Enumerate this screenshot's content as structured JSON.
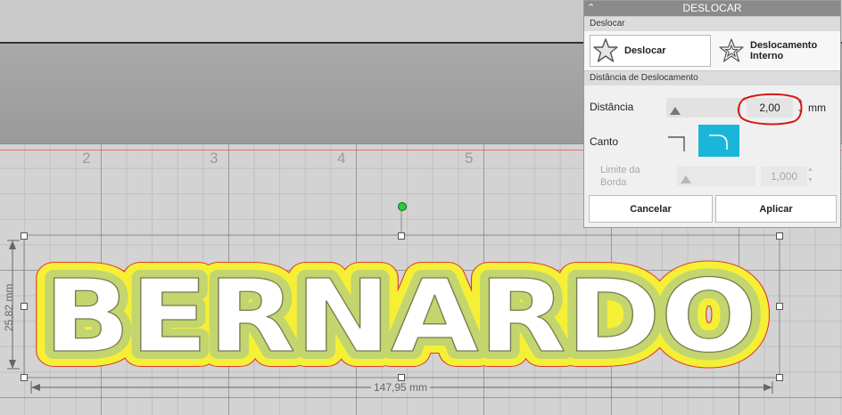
{
  "canvas": {
    "ruler_numbers": [
      "2",
      "3",
      "4",
      "5"
    ],
    "text_object": {
      "text": "BERNARDO",
      "fill_color": "#ffffff",
      "inner_offset_color": "#c3d56e",
      "outer_offset_color": "#f5f035",
      "outline_color": "#e23a2a"
    },
    "height_label": "25,82 mm",
    "width_label": "147,95 mm",
    "rotate_handle_color": "#2ecc40"
  },
  "panel": {
    "title": "DESLOCAR",
    "section_mode": "Deslocar",
    "modes": [
      {
        "label": "Deslocar",
        "selected": true
      },
      {
        "label_line1": "Deslocamento",
        "label_line2": "Interno",
        "selected": false
      }
    ],
    "section_distance": "Distância de Deslocamento",
    "distance_label": "Distância",
    "distance_value": "2,00",
    "distance_unit": "mm",
    "corner_label": "Canto",
    "corner_selected": "round",
    "limit_label_line1": "Limite da",
    "limit_label_line2": "Borda",
    "limit_value": "1,000",
    "cancel_label": "Cancelar",
    "apply_label": "Aplicar",
    "accent_color": "#1ab6d9"
  }
}
